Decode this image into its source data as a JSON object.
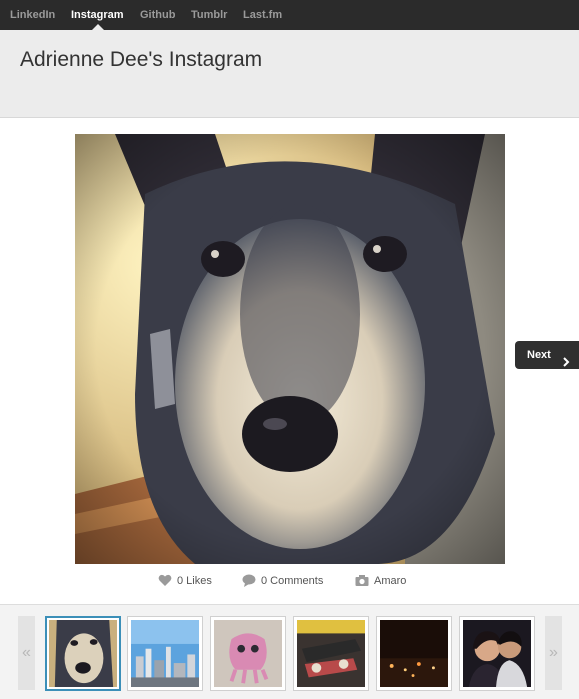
{
  "nav": {
    "tabs": [
      {
        "label": "LinkedIn",
        "active": false
      },
      {
        "label": "Instagram",
        "active": true
      },
      {
        "label": "Github",
        "active": false
      },
      {
        "label": "Tumblr",
        "active": false
      },
      {
        "label": "Last.fm",
        "active": false
      }
    ]
  },
  "header": {
    "title": "Adrienne Dee's Instagram"
  },
  "photo": {
    "subject_icon": "dog-photo"
  },
  "next_button": {
    "label": "Next",
    "icon": "chevron-right-icon"
  },
  "meta": {
    "likes": "0 Likes",
    "comments": "0 Comments",
    "filter": "Amaro"
  },
  "strip": {
    "prev_arrow": "«",
    "next_arrow": "»",
    "thumbnails": [
      {
        "name": "thumb-dog",
        "active": true
      },
      {
        "name": "thumb-city-skyline",
        "active": false
      },
      {
        "name": "thumb-pink-graffiti",
        "active": false
      },
      {
        "name": "thumb-skateboards",
        "active": false
      },
      {
        "name": "thumb-night-lights",
        "active": false
      },
      {
        "name": "thumb-couple",
        "active": false
      }
    ]
  },
  "colors": {
    "nav_bg": "#2b2b2b",
    "header_bg": "#ececec",
    "active_thumb_border": "#3b8fb8"
  }
}
